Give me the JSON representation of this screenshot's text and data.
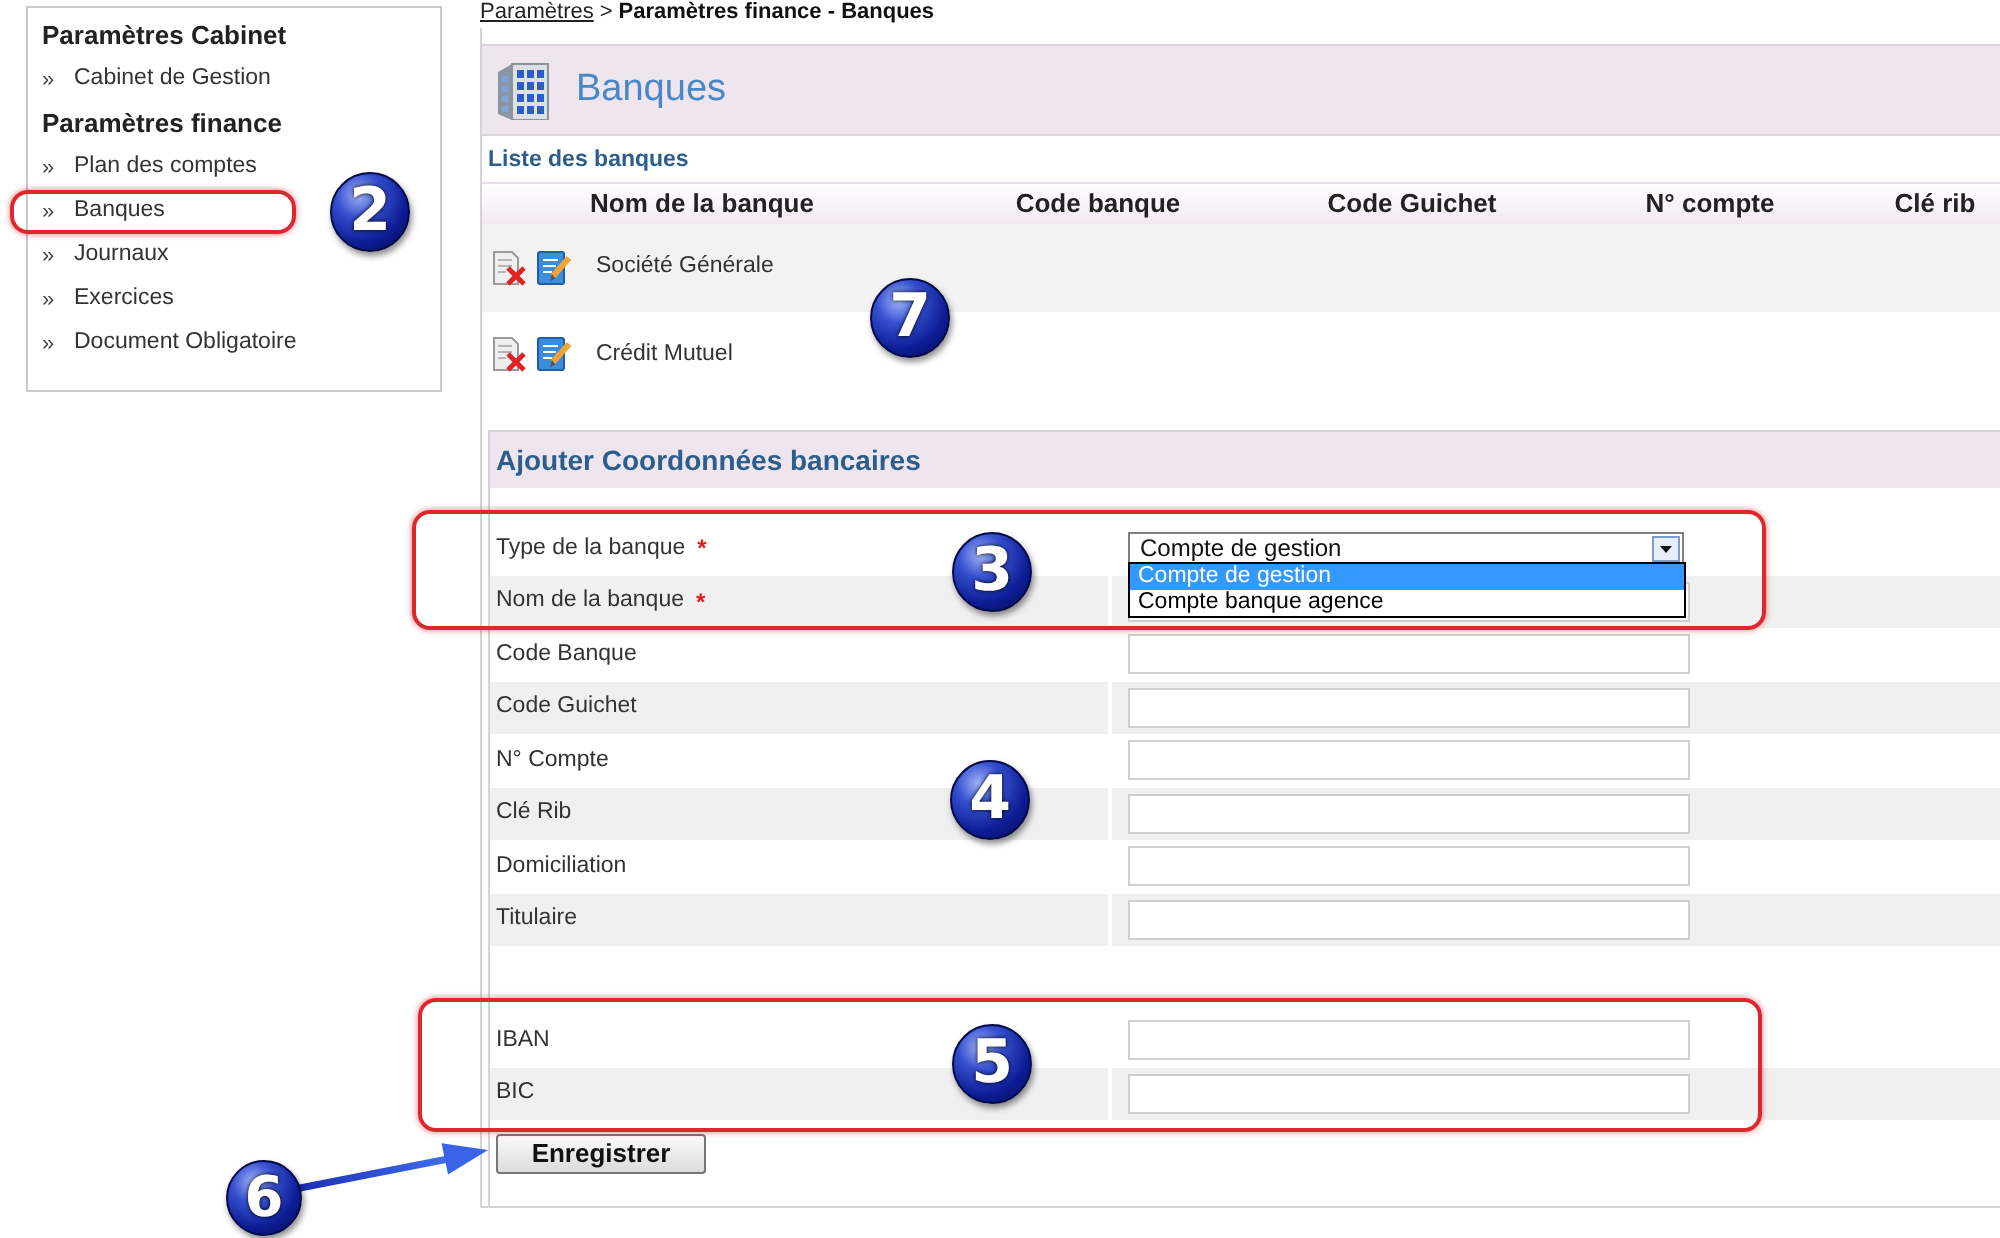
{
  "breadcrumb": {
    "link": "Paramètres",
    "separator": ">",
    "current": "Paramètres finance - Banques"
  },
  "sidebar": {
    "callout": "2",
    "sections": [
      {
        "title": "Paramètres Cabinet",
        "items": [
          {
            "marker": "»",
            "label": "Cabinet de Gestion",
            "highlighted": false
          }
        ]
      },
      {
        "title": "Paramètres finance",
        "items": [
          {
            "marker": "»",
            "label": "Plan des comptes",
            "highlighted": false
          },
          {
            "marker": "»",
            "label": "Banques",
            "highlighted": true
          },
          {
            "marker": "»",
            "label": "Journaux",
            "highlighted": false
          },
          {
            "marker": "»",
            "label": "Exercices",
            "highlighted": false
          },
          {
            "marker": "»",
            "label": "Document Obligatoire",
            "highlighted": false
          }
        ]
      }
    ]
  },
  "page_header": {
    "title": "Banques"
  },
  "bank_list": {
    "title": "Liste des banques",
    "callout": "7",
    "columns": [
      "Nom de la banque",
      "Code banque",
      "Code Guichet",
      "N° compte",
      "Clé rib"
    ],
    "rows": [
      {
        "name": "Société Générale"
      },
      {
        "name": "Crédit Mutuel"
      }
    ]
  },
  "form": {
    "title": "Ajouter Coordonnées bancaires",
    "required_mark": "*",
    "groups": [
      {
        "callout": "3",
        "highlighted": true,
        "fields": [
          {
            "kind": "select",
            "label": "Type de la banque",
            "required": true,
            "value": "Compte de gestion",
            "expanded": true,
            "options": [
              {
                "label": "Compte de gestion",
                "selected": true
              },
              {
                "label": "Compte banque agence",
                "selected": false
              }
            ]
          },
          {
            "kind": "text",
            "label": "Nom de la banque",
            "required": true
          }
        ]
      },
      {
        "callout": "4",
        "highlighted": false,
        "fields": [
          {
            "kind": "text",
            "label": "Code Banque",
            "required": false
          },
          {
            "kind": "text",
            "label": "Code Guichet",
            "required": false
          },
          {
            "kind": "text",
            "label": "N° Compte",
            "required": false
          },
          {
            "kind": "text",
            "label": "Clé Rib",
            "required": false
          },
          {
            "kind": "text",
            "label": "Domiciliation",
            "required": false
          },
          {
            "kind": "text",
            "label": "Titulaire",
            "required": false
          }
        ]
      },
      {
        "callout": "5",
        "highlighted": true,
        "fields": [
          {
            "kind": "text",
            "label": "IBAN",
            "required": false
          },
          {
            "kind": "text",
            "label": "BIC",
            "required": false
          }
        ]
      }
    ],
    "submit": {
      "label": "Enregistrer",
      "callout": "6"
    }
  }
}
